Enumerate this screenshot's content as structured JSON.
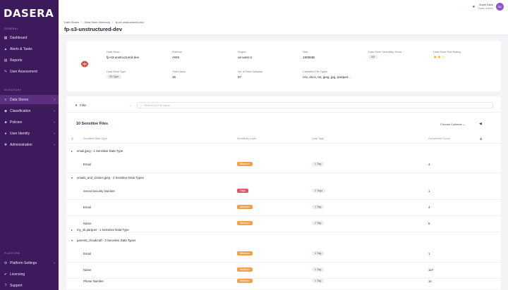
{
  "app": {
    "logo": "DASERA"
  },
  "sidebar": {
    "sections": [
      {
        "label": "GENERAL",
        "items": [
          {
            "icon": "▦",
            "label": "Dashboard"
          },
          {
            "icon": "▲",
            "label": "Alerts & Tasks"
          },
          {
            "icon": "▤",
            "label": "Reports"
          },
          {
            "icon": "✎",
            "label": "User Assessment"
          }
        ]
      },
      {
        "label": "INVENTORY",
        "items": [
          {
            "icon": "≡",
            "label": "Data Stores",
            "active": true
          },
          {
            "icon": "◆",
            "label": "Classification"
          },
          {
            "icon": "■",
            "label": "Policies"
          },
          {
            "icon": "●",
            "label": "User Identity"
          },
          {
            "icon": "✚",
            "label": "Administration"
          }
        ]
      }
    ],
    "bottom_section": "PLATFORM",
    "bottom_items": [
      {
        "icon": "⚙",
        "label": "Platform Settings"
      },
      {
        "icon": "✔",
        "label": "Licensing"
      },
      {
        "icon": "?",
        "label": "Support"
      }
    ]
  },
  "header": {
    "breadcrumb": [
      "Data Stores",
      "›",
      "Data Store Inventory",
      "›",
      "fp-s3-unstructured-dev"
    ],
    "title": "fp-s3-unstructured-dev",
    "user": {
      "name": "Super Dave",
      "role": "Super Admin",
      "initials": "SD"
    }
  },
  "info": {
    "fields": [
      {
        "label": "Data Store",
        "value": "fp-s3-unstructured-dev"
      },
      {
        "label": "Platform",
        "value": "AWS"
      },
      {
        "label": "Region",
        "value": "us-west-2"
      },
      {
        "label": "Size",
        "value": "1905MB"
      },
      {
        "label": "Data Store Sensitivity Score",
        "value": "3/5"
      },
      {
        "label": "Data Store Risk Rating",
        "value": "★★☆"
      },
      {
        "label": "Data Store Type",
        "value": "S3 Type"
      },
      {
        "label": "Total Users",
        "value": "36"
      },
      {
        "label": "No. of Files Sampled",
        "value": "97"
      },
      {
        "label": "Classified File Types",
        "value": "csv, docx, txt, jpeg, jpg, parquet..."
      }
    ]
  },
  "table": {
    "filter_label": "Filter",
    "search_placeholder": "Search by File name",
    "title": "10 Sensitive Files",
    "choose_columns": "Choose Columns",
    "headers": [
      "Sensitive Data Type",
      "Sensitivity Level",
      "Data Tags",
      "Occurrence Count"
    ],
    "groups": [
      {
        "label": "email.jpeg - 1 Sensitive Data Type",
        "rows": [
          {
            "name": "Email",
            "level": "Medium",
            "tag": "1 Tag",
            "count": "4"
          }
        ]
      },
      {
        "label": "emails_and_visitors.jpeg - 3 Sensitive Data Types",
        "rows": [
          {
            "name": "Social Security Number",
            "level": "High",
            "tag": "2 Tags",
            "count": "1"
          },
          {
            "name": "Email",
            "level": "Medium",
            "tag": "1 Tag",
            "count": "4"
          },
          {
            "name": "Name",
            "level": "Medium",
            "tag": "1 Tag",
            "count": "5"
          }
        ]
      },
      {
        "label": "my_sk.parquet - 1 Sensitive Data Type",
        "rows": []
      },
      {
        "label": "parent3_cloudcraft - 3 Sensitive Data Types",
        "rows": [
          {
            "name": "Email",
            "level": "Medium",
            "tag": "1 Tag",
            "count": "1"
          },
          {
            "name": "Name",
            "level": "Medium",
            "tag": "1 Tag",
            "count": "127"
          },
          {
            "name": "Phone Number",
            "level": "Medium",
            "tag": "1 Tag",
            "count": "14"
          }
        ]
      }
    ]
  },
  "colors": {
    "sidebar_bg": "#3d1a5c",
    "accent": "#5a2f80",
    "medium": "#f0a04b",
    "high": "#e0566b"
  }
}
